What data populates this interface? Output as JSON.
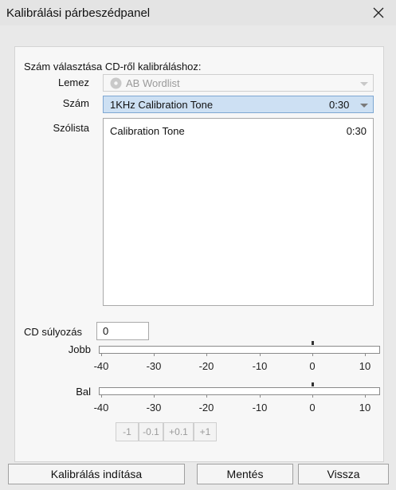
{
  "window": {
    "title": "Kalibrálási párbeszédpanel"
  },
  "section": {
    "heading": "Szám választása CD-ről kalibráláshoz:"
  },
  "disc": {
    "label": "Lemez",
    "value": "AB Wordlist"
  },
  "track": {
    "label": "Szám",
    "name": "1KHz Calibration Tone",
    "time": "0:30"
  },
  "wordlist": {
    "label": "Szólista",
    "items": [
      {
        "name": "Calibration Tone",
        "time": "0:30"
      }
    ]
  },
  "weighting": {
    "label": "CD súlyozás",
    "value": "0"
  },
  "meters": {
    "right_label": "Jobb",
    "left_label": "Bal",
    "ticks": [
      "-40",
      "-30",
      "-20",
      "-10",
      "0",
      "10"
    ],
    "marker_db": 0
  },
  "steps": [
    "-1",
    "-0.1",
    "+0.1",
    "+1"
  ],
  "buttons": {
    "start": "Kalibrálás indítása",
    "save": "Mentés",
    "back": "Vissza"
  }
}
